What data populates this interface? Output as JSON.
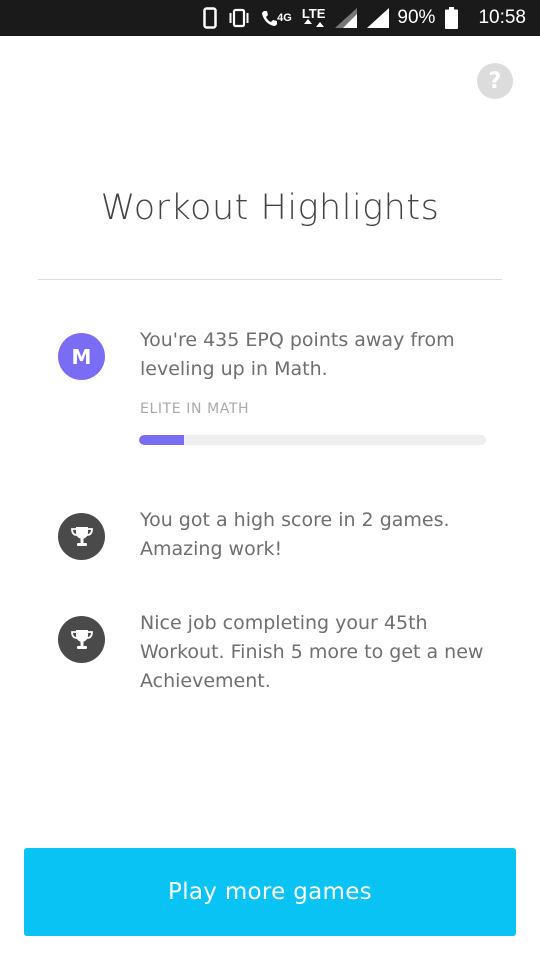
{
  "status_bar": {
    "network_4g": "4G",
    "network_lte": "LTE",
    "battery_percent": "90%",
    "time": "10:58",
    "icons": [
      "phone-icon",
      "vibrate-icon",
      "wifi-call-icon",
      "signal-icon",
      "signal-icon",
      "battery-icon"
    ]
  },
  "help": {
    "label": "?"
  },
  "page_title": "Workout Highlights",
  "highlights": [
    {
      "icon_letter": "M",
      "icon_color": "#7b6cf6",
      "text": "You're 435 EPQ points away from leveling up in Math.",
      "label": "ELITE IN MATH",
      "progress": 0.13
    },
    {
      "icon": "trophy-icon",
      "icon_color": "#4a4a4a",
      "text": "You got a high score in 2 games. Amazing work!"
    },
    {
      "icon": "trophy-icon",
      "icon_color": "#4a4a4a",
      "text": "Nice job completing your 45th Workout. Finish 5 more to get a new Achievement."
    }
  ],
  "play_button": {
    "label": "Play more games",
    "color": "#09c3f5"
  }
}
